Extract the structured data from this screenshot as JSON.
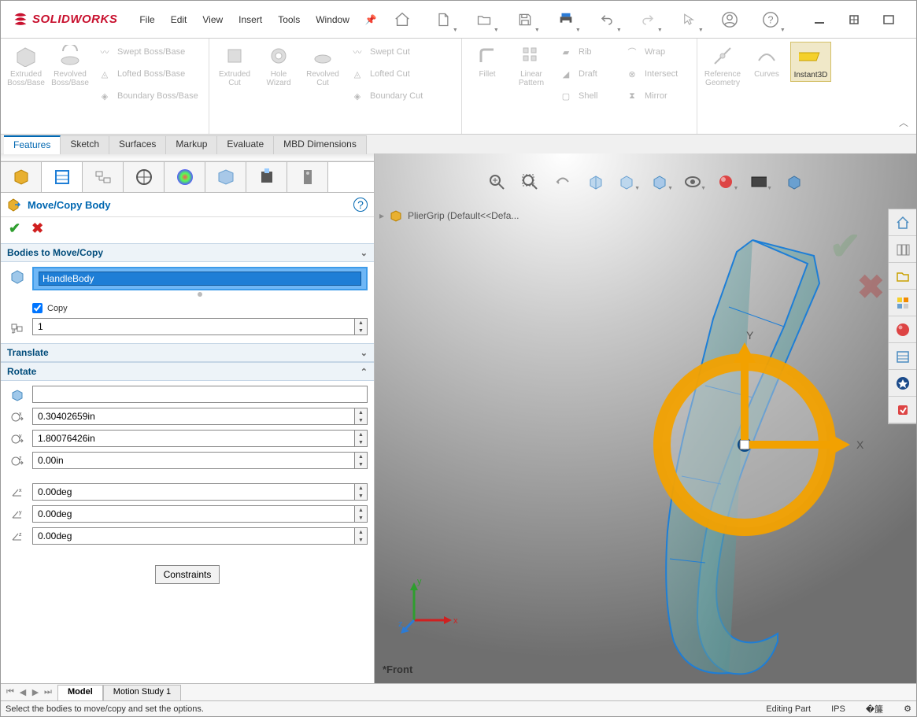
{
  "app": {
    "brand": "SOLIDWORKS"
  },
  "menu": [
    "File",
    "Edit",
    "View",
    "Insert",
    "Tools",
    "Window"
  ],
  "ribbon_tabs": [
    "Features",
    "Sketch",
    "Surfaces",
    "Markup",
    "Evaluate",
    "MBD Dimensions"
  ],
  "ribbon": {
    "g1_big": [
      {
        "label": "Extruded Boss/Base"
      },
      {
        "label": "Revolved Boss/Base"
      }
    ],
    "g1_small": [
      "Swept Boss/Base",
      "Lofted Boss/Base",
      "Boundary Boss/Base"
    ],
    "g2_big": [
      {
        "label": "Extruded Cut"
      },
      {
        "label": "Hole Wizard"
      },
      {
        "label": "Revolved Cut"
      }
    ],
    "g2_small": [
      "Swept Cut",
      "Lofted Cut",
      "Boundary Cut"
    ],
    "g3_big": [
      {
        "label": "Fillet"
      },
      {
        "label": "Linear Pattern"
      }
    ],
    "g3_small": [
      "Rib",
      "Draft",
      "Shell",
      "Wrap",
      "Intersect",
      "Mirror"
    ],
    "g4_big": [
      {
        "label": "Reference Geometry"
      },
      {
        "label": "Curves"
      },
      {
        "label": "Instant3D"
      }
    ]
  },
  "pm": {
    "title": "Move/Copy Body",
    "section_bodies": "Bodies to Move/Copy",
    "selected_body": "HandleBody",
    "copy_label": "Copy",
    "copy_checked": true,
    "copy_count": "1",
    "section_translate": "Translate",
    "section_rotate": "Rotate",
    "rotate_ref": "",
    "cx": "0.30402659in",
    "cy": "1.80076426in",
    "cz": "0.00in",
    "rx": "0.00deg",
    "ry": "0.00deg",
    "rz": "0.00deg",
    "constraints_btn": "Constraints"
  },
  "viewport": {
    "crumb_text": "PlierGrip (Default<<Defa...",
    "view_label": "*Front",
    "axis_x": "X",
    "axis_y": "Y",
    "mini_x": "x",
    "mini_y": "y",
    "mini_z": "z"
  },
  "bottom_tabs": {
    "model": "Model",
    "motion": "Motion Study 1"
  },
  "status": {
    "hint": "Select the bodies to move/copy and set the options.",
    "mode": "Editing Part",
    "units": "IPS"
  }
}
